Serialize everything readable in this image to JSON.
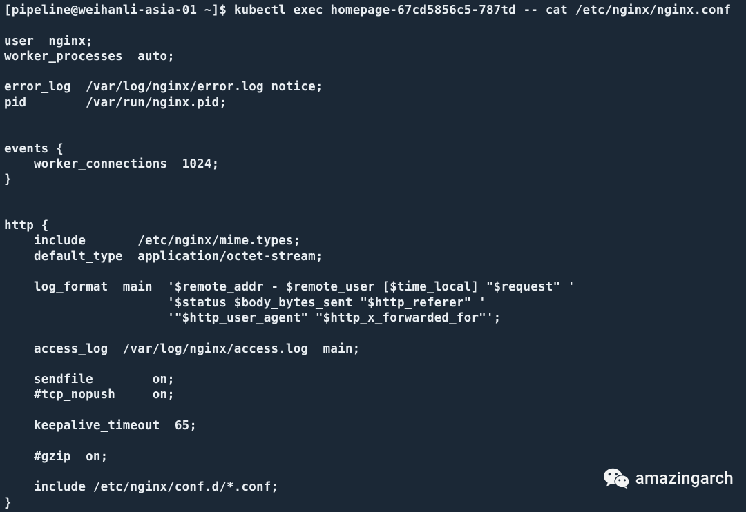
{
  "prompt": {
    "user": "pipeline",
    "host": "weihanli-asia-01",
    "cwd": "~",
    "symbol": "$",
    "command": "kubectl exec homepage-67cd5856c5-787td -- cat /etc/nginx/nginx.conf"
  },
  "output": [
    "",
    "user  nginx;",
    "worker_processes  auto;",
    "",
    "error_log  /var/log/nginx/error.log notice;",
    "pid        /var/run/nginx.pid;",
    "",
    "",
    "events {",
    "    worker_connections  1024;",
    "}",
    "",
    "",
    "http {",
    "    include       /etc/nginx/mime.types;",
    "    default_type  application/octet-stream;",
    "",
    "    log_format  main  '$remote_addr - $remote_user [$time_local] \"$request\" '",
    "                      '$status $body_bytes_sent \"$http_referer\" '",
    "                      '\"$http_user_agent\" \"$http_x_forwarded_for\"';",
    "",
    "    access_log  /var/log/nginx/access.log  main;",
    "",
    "    sendfile        on;",
    "    #tcp_nopush     on;",
    "",
    "    keepalive_timeout  65;",
    "",
    "    #gzip  on;",
    "",
    "    include /etc/nginx/conf.d/*.conf;",
    "}"
  ],
  "watermark": {
    "text": "amazingarch",
    "icon": "wechat-icon"
  }
}
